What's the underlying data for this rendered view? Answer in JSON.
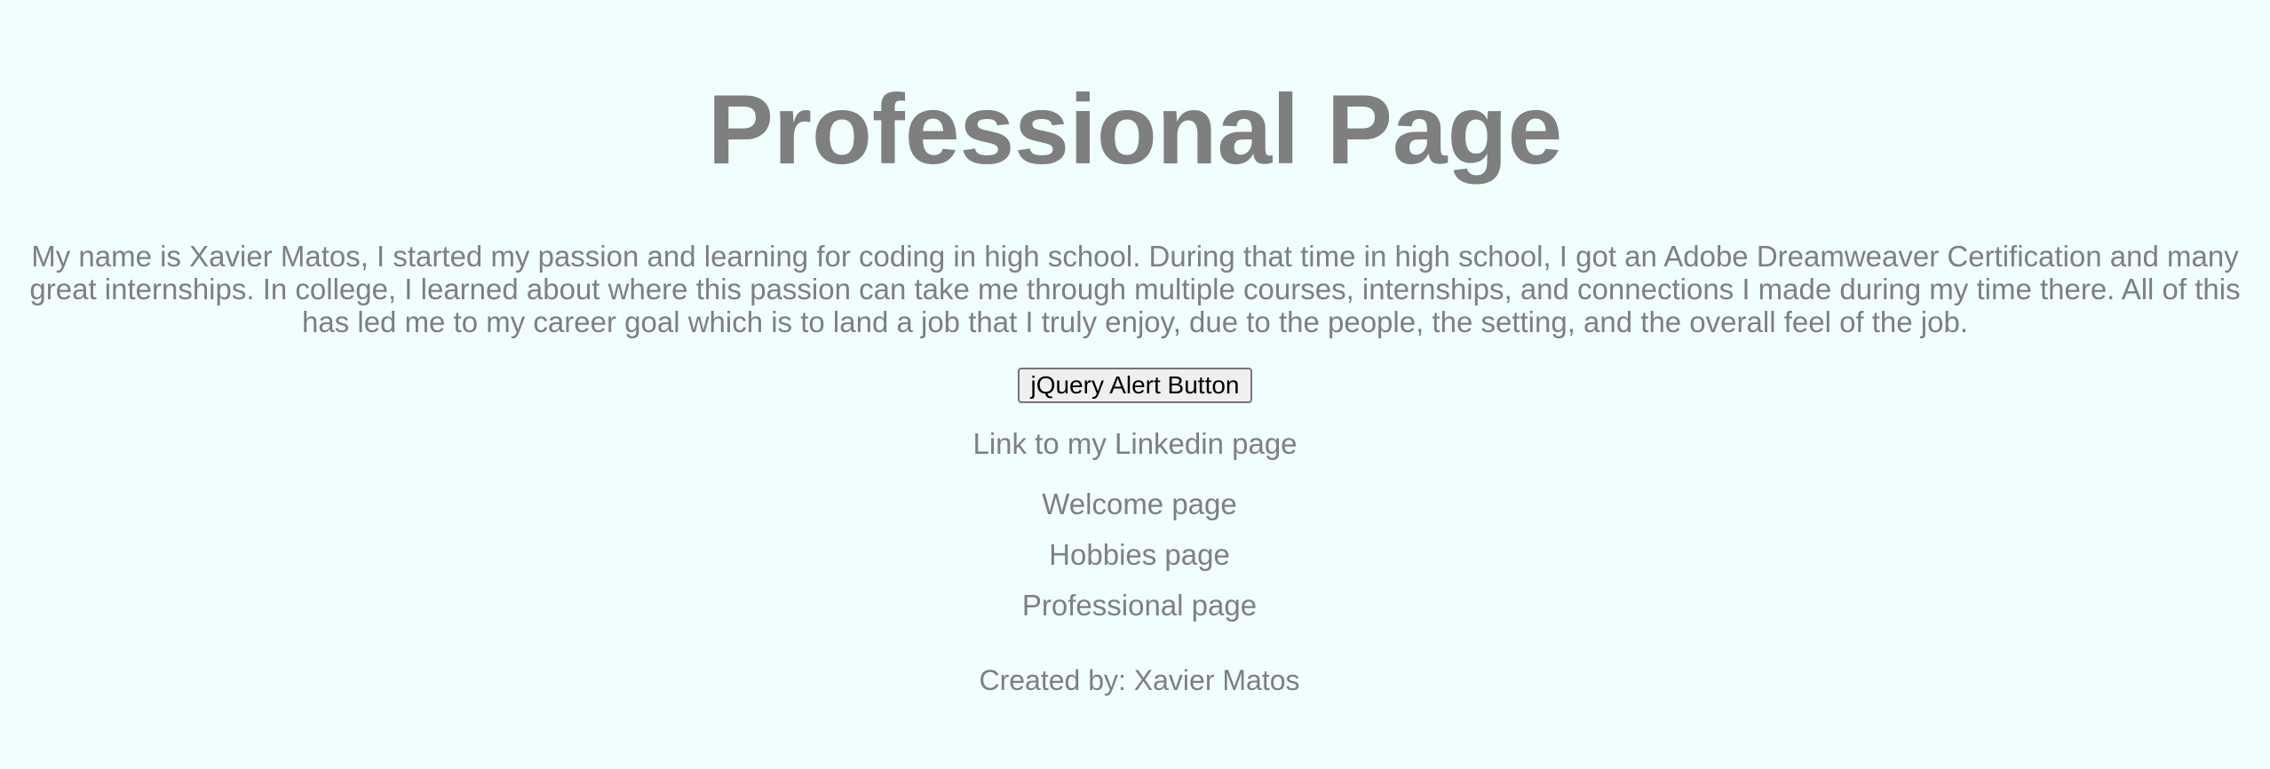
{
  "header": {
    "title": "Professional Page"
  },
  "main": {
    "intro": "My name is Xavier Matos, I started my passion and learning for coding in high school. During that time in high school, I got an Adobe Dreamweaver Certification and many great internships. In college, I learned about where this passion can take me through multiple courses, internships, and connections I made during my time there. All of this has led me to my career goal which is to land a job that I truly enjoy, due to the people, the setting, and the overall feel of the job.",
    "alert_button_label": "jQuery Alert Button",
    "linkedin_link": "Link to my Linkedin page"
  },
  "nav": {
    "items": [
      {
        "label": "Welcome page"
      },
      {
        "label": "Hobbies page"
      },
      {
        "label": "Professional page"
      }
    ]
  },
  "footer": {
    "credit": "Created by: Xavier Matos"
  },
  "colors": {
    "background": "#f0fffe",
    "text": "#7f7f7f"
  }
}
